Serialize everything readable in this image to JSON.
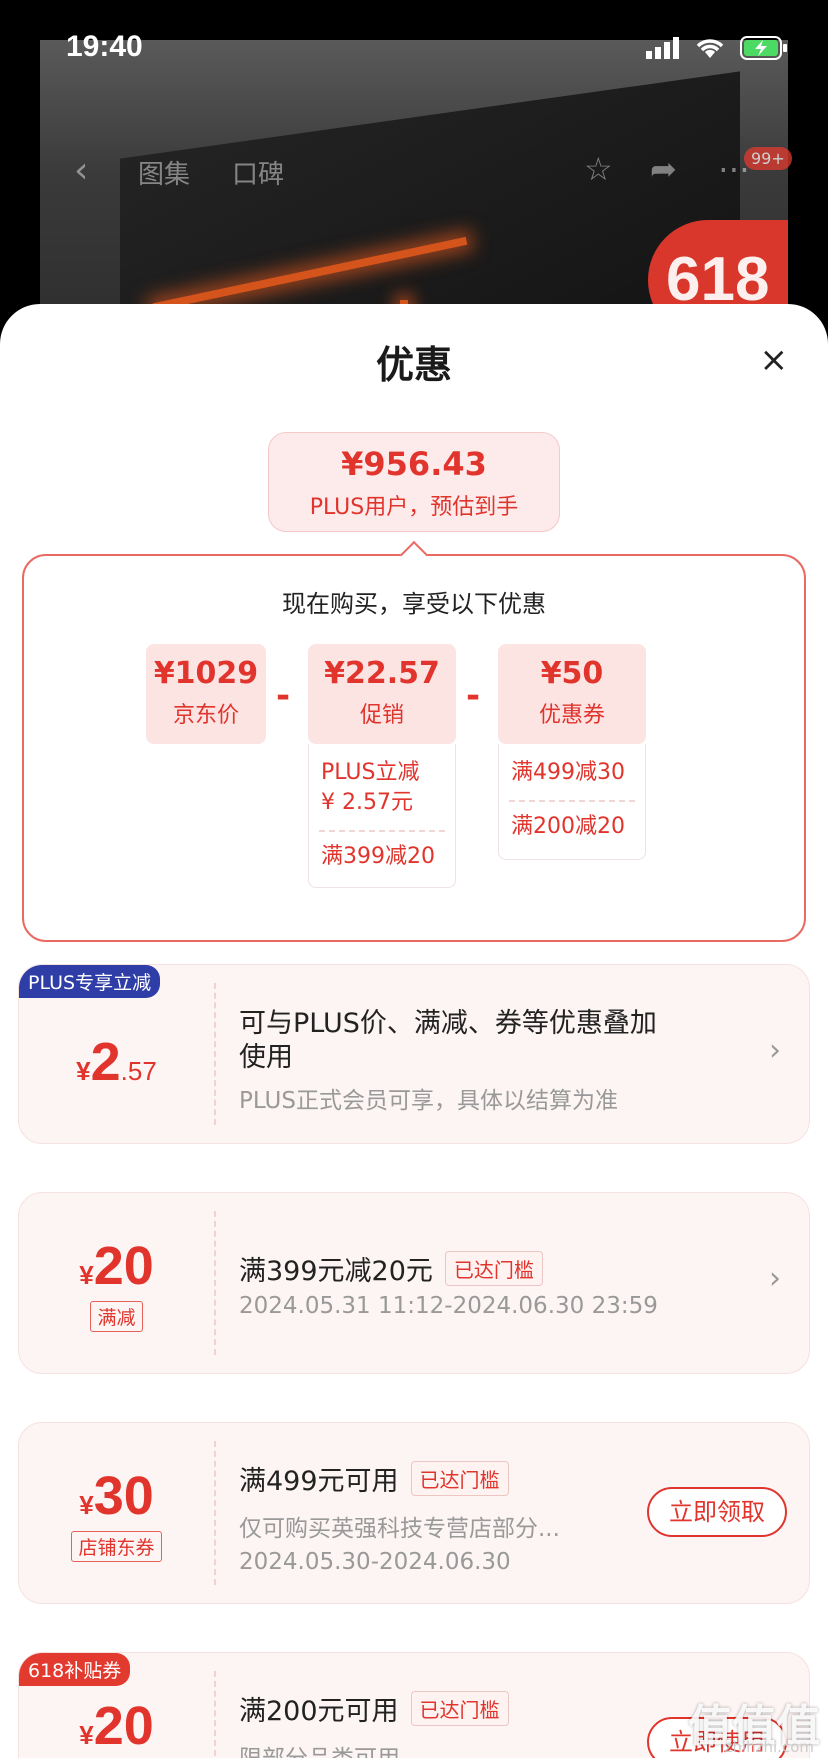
{
  "status": {
    "time": "19:40"
  },
  "nav": {
    "back_icon": "‹",
    "tab_gallery": "图集",
    "tab_reviews": "口碑",
    "badge": "99+",
    "banner_text": "618"
  },
  "sheet": {
    "title": "优惠",
    "close_icon": "×"
  },
  "final_price": {
    "amount": "¥956.43",
    "caption": "PLUS用户，预估到手"
  },
  "breakdown": {
    "heading": "现在购买，享受以下优惠",
    "jd_price": {
      "value": "¥1029",
      "label": "京东价"
    },
    "promo": {
      "value": "¥22.57",
      "label": "促销",
      "lines": [
        "PLUS立减",
        "¥ 2.57元"
      ],
      "extra": "满399减20"
    },
    "coupon": {
      "value": "¥50",
      "label": "优惠券",
      "line1": "满499减30",
      "line2": "满200减20"
    },
    "minus": "-"
  },
  "cards": [
    {
      "badge": "PLUS专享立减",
      "currency": "¥",
      "int": "2",
      "dec": ".57",
      "title_line1": "可与PLUS价、满减、券等优惠叠加",
      "title_line2": "使用",
      "desc": "PLUS正式会员可享，具体以结算为准"
    },
    {
      "currency": "¥",
      "int": "20",
      "tag": "满减",
      "title": "满399元减20元",
      "reached": "已达门槛",
      "desc": "2024.05.31 11:12-2024.06.30 23:59"
    },
    {
      "currency": "¥",
      "int": "30",
      "tag": "店铺东券",
      "title": "满499元可用",
      "reached": "已达门槛",
      "desc1": "仅可购买英强科技专营店部分...",
      "desc2": "2024.05.30-2024.06.30",
      "button": "立即领取"
    },
    {
      "badge": "618补贴券",
      "currency": "¥",
      "int": "20",
      "title": "满200元可用",
      "reached": "已达门槛",
      "desc": "限部分品类可用",
      "button": "立即使用"
    }
  ],
  "watermark": {
    "main": "值值值",
    "sub": "zhihzhi.com"
  },
  "colors": {
    "accent": "#e0342c",
    "plus_badge": "#2f3da6",
    "subsidy_badge": "#e23a2e"
  }
}
